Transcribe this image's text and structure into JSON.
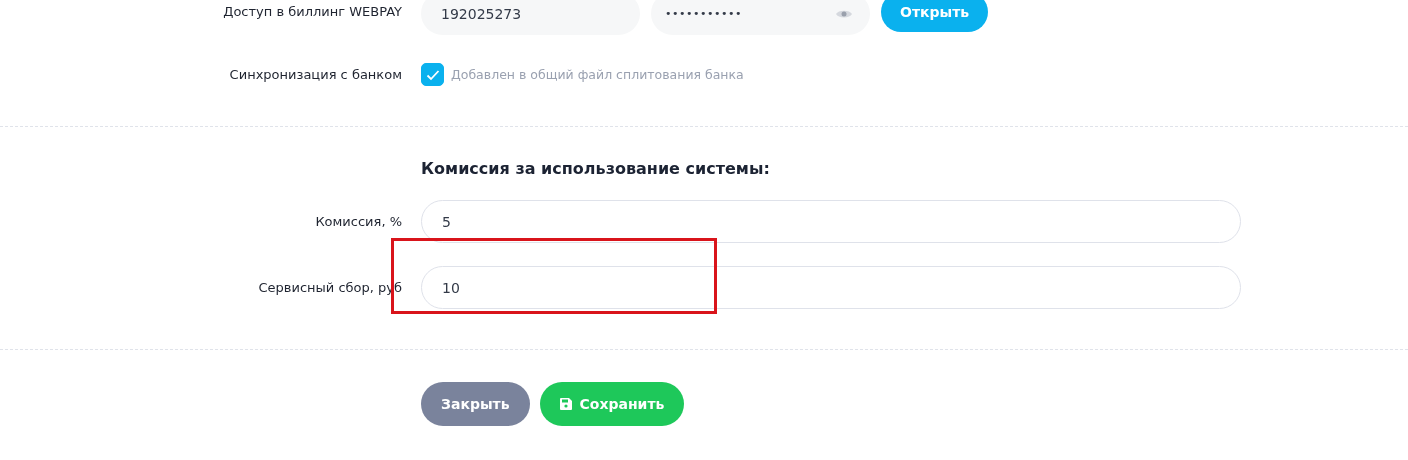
{
  "billing": {
    "label": "Доступ в биллинг WEBPAY",
    "login": "192025273",
    "password": "•••••••••••",
    "open_button": "Открыть"
  },
  "bank_sync": {
    "label": "Синхронизация с банком",
    "checked": true,
    "hint": "Добавлен в общий файл сплитования банка"
  },
  "commission": {
    "heading": "Комиссия за использование системы:",
    "fields": [
      {
        "label": "Комиссия, %",
        "value": "5"
      },
      {
        "label": "Сервисный сбор, руб",
        "value": "10"
      }
    ]
  },
  "buttons": [
    {
      "kind": "close",
      "label": "Закрыть"
    },
    {
      "kind": "save",
      "label": "Сохранить"
    }
  ],
  "highlight_frame": true
}
